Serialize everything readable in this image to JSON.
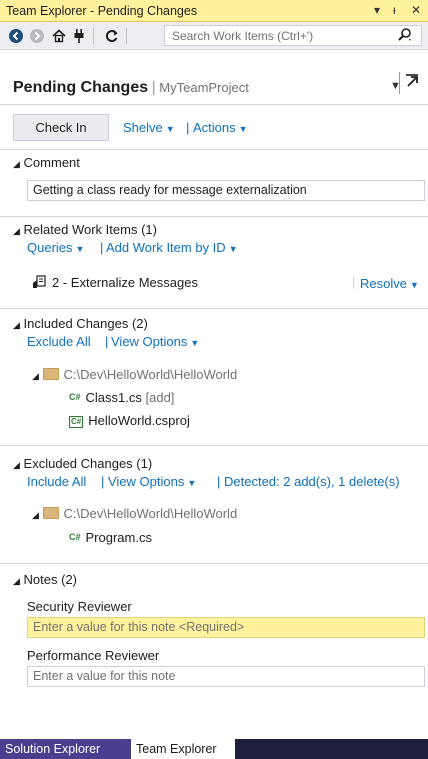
{
  "window": {
    "title": "Team Explorer - Pending Changes",
    "controls": {
      "dropdown": "▾",
      "pin": "ᵻ",
      "close": "✕"
    }
  },
  "toolbar": {
    "search_placeholder": "Search Work Items (Ctrl+')",
    "search_icon": "search-icon",
    "icons": [
      "back-arrow-icon",
      "forward-arrow-icon",
      "home-icon",
      "connect-plug-icon",
      "refresh-icon"
    ]
  },
  "page": {
    "title": "Pending Changes",
    "separator": "|",
    "project": "MyTeamProject"
  },
  "actions": {
    "checkin_label": "Check In",
    "shelve_label": "Shelve",
    "actions_label": "Actions"
  },
  "comment": {
    "heading": "Comment",
    "value": "Getting a class ready for message externalization"
  },
  "related": {
    "heading": "Related Work Items (1)",
    "queries_label": "Queries",
    "add_by_id_label": "Add Work Item by ID",
    "item_text": "2 - Externalize Messages",
    "resolve_label": "Resolve"
  },
  "included": {
    "heading": "Included Changes (2)",
    "exclude_all": "Exclude All",
    "view_options": "View Options",
    "folder": "C:\\Dev\\HelloWorld\\HelloWorld",
    "files": [
      {
        "name": "Class1.cs",
        "tag": "[add]",
        "badge": "C#"
      },
      {
        "name": "HelloWorld.csproj",
        "tag": "",
        "badge": "C#"
      }
    ]
  },
  "excluded": {
    "heading": "Excluded Changes (1)",
    "include_all": "Include All",
    "view_options": "View Options",
    "detected": "Detected: 2 add(s), 1 delete(s)",
    "folder": "C:\\Dev\\HelloWorld\\HelloWorld",
    "files": [
      {
        "name": "Program.cs",
        "badge": "C#"
      }
    ]
  },
  "notes": {
    "heading": "Notes (2)",
    "security_label": "Security Reviewer",
    "security_placeholder": "Enter a value for this note <Required>",
    "performance_label": "Performance Reviewer",
    "performance_placeholder": "Enter a value for this note"
  },
  "bottom_tabs": [
    {
      "label": "Solution Explorer",
      "active": false
    },
    {
      "label": "Team Explorer",
      "active": true
    }
  ],
  "colors": {
    "title_bar": "#fff29d",
    "link": "#0e70c0",
    "required_field": "#fff29d",
    "inactive_tab": "#4a3f8f",
    "tab_strip": "#2d2d30"
  }
}
